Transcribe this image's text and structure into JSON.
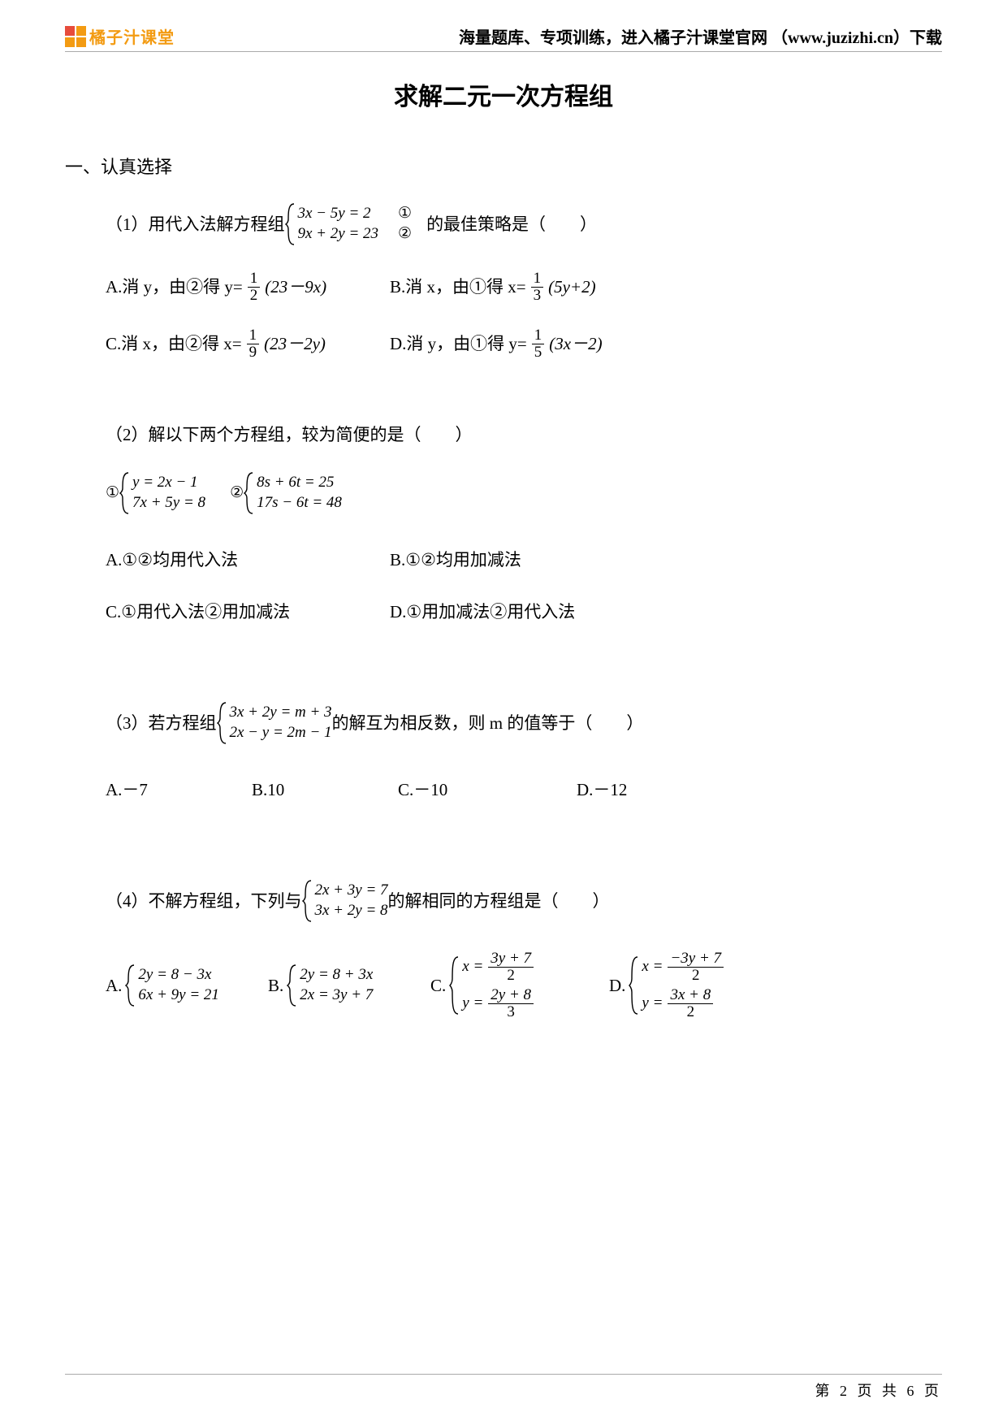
{
  "header": {
    "logo_text": "橘子汁课堂",
    "right_text": "海量题库、专项训练，进入橘子汁课堂官网 （www.juzizhi.cn）下载"
  },
  "title": "求解二元一次方程组",
  "section1_label": "一、认真选择",
  "q1": {
    "prefix": "（1）用代入法解方程组",
    "eq1": "3x − 5y = 2",
    "eq2": "9x + 2y = 23",
    "mark1": "①",
    "mark2": "②",
    "suffix": "的最佳策略是（　　）",
    "optA_pre": "A.消 y，由②得 y=",
    "optA_num": "1",
    "optA_den": "2",
    "optA_post": "(23－9x)",
    "optB_pre": "B.消 x，由①得 x=",
    "optB_num": "1",
    "optB_den": "3",
    "optB_post": "(5y+2)",
    "optC_pre": "C.消 x，由②得 x=",
    "optC_num": "1",
    "optC_den": "9",
    "optC_post": "(23－2y)",
    "optD_pre": "D.消 y，由①得 y=",
    "optD_num": "1",
    "optD_den": "5",
    "optD_post": "(3x－2)"
  },
  "q2": {
    "prefix": "（2）解以下两个方程组，较为简便的是（　　）",
    "mark1": "①",
    "sys1_a": "y = 2x − 1",
    "sys1_b": "7x + 5y = 8",
    "mark2": "②",
    "sys2_a": "8s + 6t = 25",
    "sys2_b": "17s − 6t = 48",
    "optA": "A.①②均用代入法",
    "optB": "B.①②均用加减法",
    "optC": "C.①用代入法②用加减法",
    "optD": "D.①用加减法②用代入法"
  },
  "q3": {
    "prefix": "（3）若方程组",
    "eq1": "3x + 2y = m + 3",
    "eq2": "2x − y = 2m − 1",
    "suffix": "的解互为相反数，则 m 的值等于（　　）",
    "optA": "A.－7",
    "optB": "B.10",
    "optC": "C.－10",
    "optD": "D.－12"
  },
  "q4": {
    "prefix": "（4）不解方程组，下列与",
    "eq1": "2x + 3y = 7",
    "eq2": "3x + 2y = 8",
    "suffix": "的解相同的方程组是（　　）",
    "A_label": "A.",
    "A_a": "2y = 8 − 3x",
    "A_b": "6x + 9y = 21",
    "B_label": "B.",
    "B_a": "2y = 8 + 3x",
    "B_b": "2x = 3y + 7",
    "C_label": "C.",
    "C_a_lhs": "x =",
    "C_a_num": "3y + 7",
    "C_a_den": "2",
    "C_b_lhs": "y =",
    "C_b_num": "2y + 8",
    "C_b_den": "3",
    "D_label": "D.",
    "D_a_lhs": "x =",
    "D_a_num": "−3y + 7",
    "D_a_den": "2",
    "D_b_lhs": "y =",
    "D_b_num": "3x + 8",
    "D_b_den": "2"
  },
  "footer": "第 2 页 共 6 页"
}
